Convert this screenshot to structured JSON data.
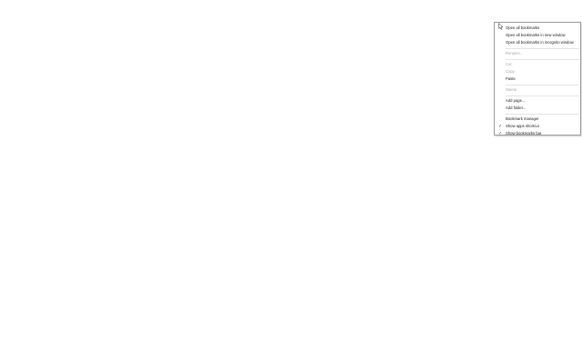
{
  "context_menu": {
    "items": [
      {
        "label": "Open all bookmarks",
        "enabled": true
      },
      {
        "label": "Open all bookmarks in new window",
        "enabled": true
      },
      {
        "label": "Open all bookmarks in incognito window",
        "enabled": true
      },
      {
        "label": "Rename...",
        "enabled": false
      },
      {
        "label": "Cut",
        "enabled": false
      },
      {
        "label": "Copy",
        "enabled": false
      },
      {
        "label": "Paste",
        "enabled": true
      },
      {
        "label": "Delete",
        "enabled": false
      },
      {
        "label": "Add page...",
        "enabled": true
      },
      {
        "label": "Add folder...",
        "enabled": true
      },
      {
        "label": "Bookmark manager",
        "enabled": true
      },
      {
        "label": "Show apps shortcut",
        "enabled": true,
        "checked": true
      },
      {
        "label": "Show bookmarks bar",
        "enabled": true,
        "checked": true
      }
    ]
  },
  "icons": {
    "cursor": "arrow-cursor-icon",
    "check": "checkmark-icon"
  },
  "colors": {
    "menu_text": "#202020",
    "disabled_text": "#a8a8a8",
    "border": "#9a9a9a",
    "separator": "#e2e2e2"
  }
}
